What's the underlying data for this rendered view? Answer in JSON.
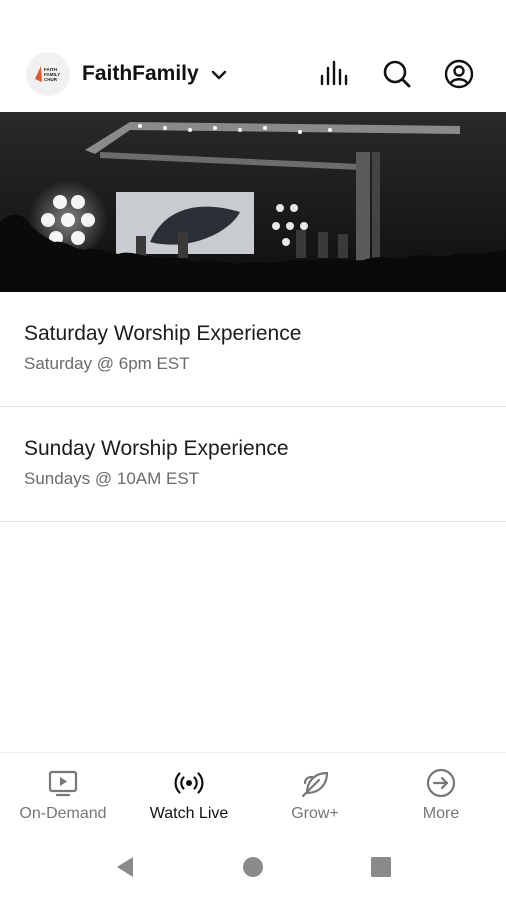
{
  "header": {
    "logo_text": "FAITH FAMILY CHUR",
    "brand": "FaithFamily",
    "icons": [
      "chevron-down-icon",
      "audio-bars-icon",
      "search-icon",
      "account-icon"
    ]
  },
  "hero": {
    "image": "worship-stage-photo"
  },
  "events": [
    {
      "title": "Saturday Worship Experience",
      "subtitle": "Saturday @ 6pm EST"
    },
    {
      "title": "Sunday Worship Experience",
      "subtitle": "Sundays @ 10AM EST"
    }
  ],
  "tabs": [
    {
      "label": "On-Demand",
      "icon": "tv-play-icon"
    },
    {
      "label": "Watch Live",
      "icon": "broadcast-icon",
      "active": true
    },
    {
      "label": "Grow+",
      "icon": "leaf-icon"
    },
    {
      "label": "More",
      "icon": "arrow-circle-icon"
    }
  ],
  "system_nav": [
    "back-icon",
    "home-icon",
    "recents-icon"
  ],
  "colors": {
    "active": "#111111",
    "inactive": "#777777",
    "divider": "#e6e6e6"
  }
}
